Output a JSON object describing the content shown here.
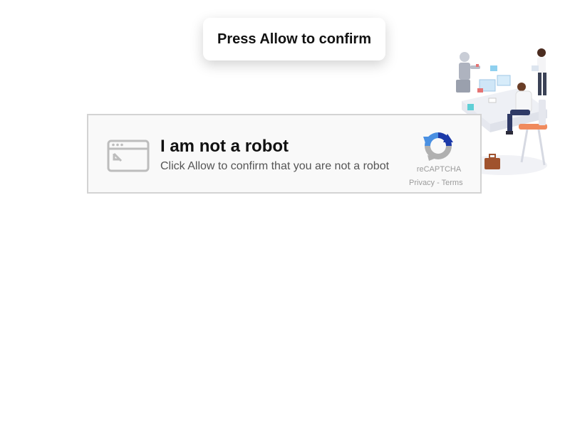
{
  "toast": {
    "message": "Press Allow to confirm"
  },
  "captcha": {
    "title": "I am not a robot",
    "subtitle": "Click Allow to confirm that you are not a robot",
    "brand": "reCAPTCHA",
    "privacy_link": "Privacy",
    "separator": " - ",
    "terms_link": "Terms"
  },
  "icons": {
    "browser": "browser-window-cursor-icon",
    "logo": "recaptcha-logo-icon",
    "illustration": "office-robot-illustration"
  },
  "colors": {
    "card_background": "#f9f9f9",
    "card_border": "#d3d3d3",
    "logo_blue": "#4a90e2",
    "logo_dark_blue": "#1c3aa9",
    "logo_gray": "#b0b0b0",
    "muted_text": "#9b9b9b"
  }
}
